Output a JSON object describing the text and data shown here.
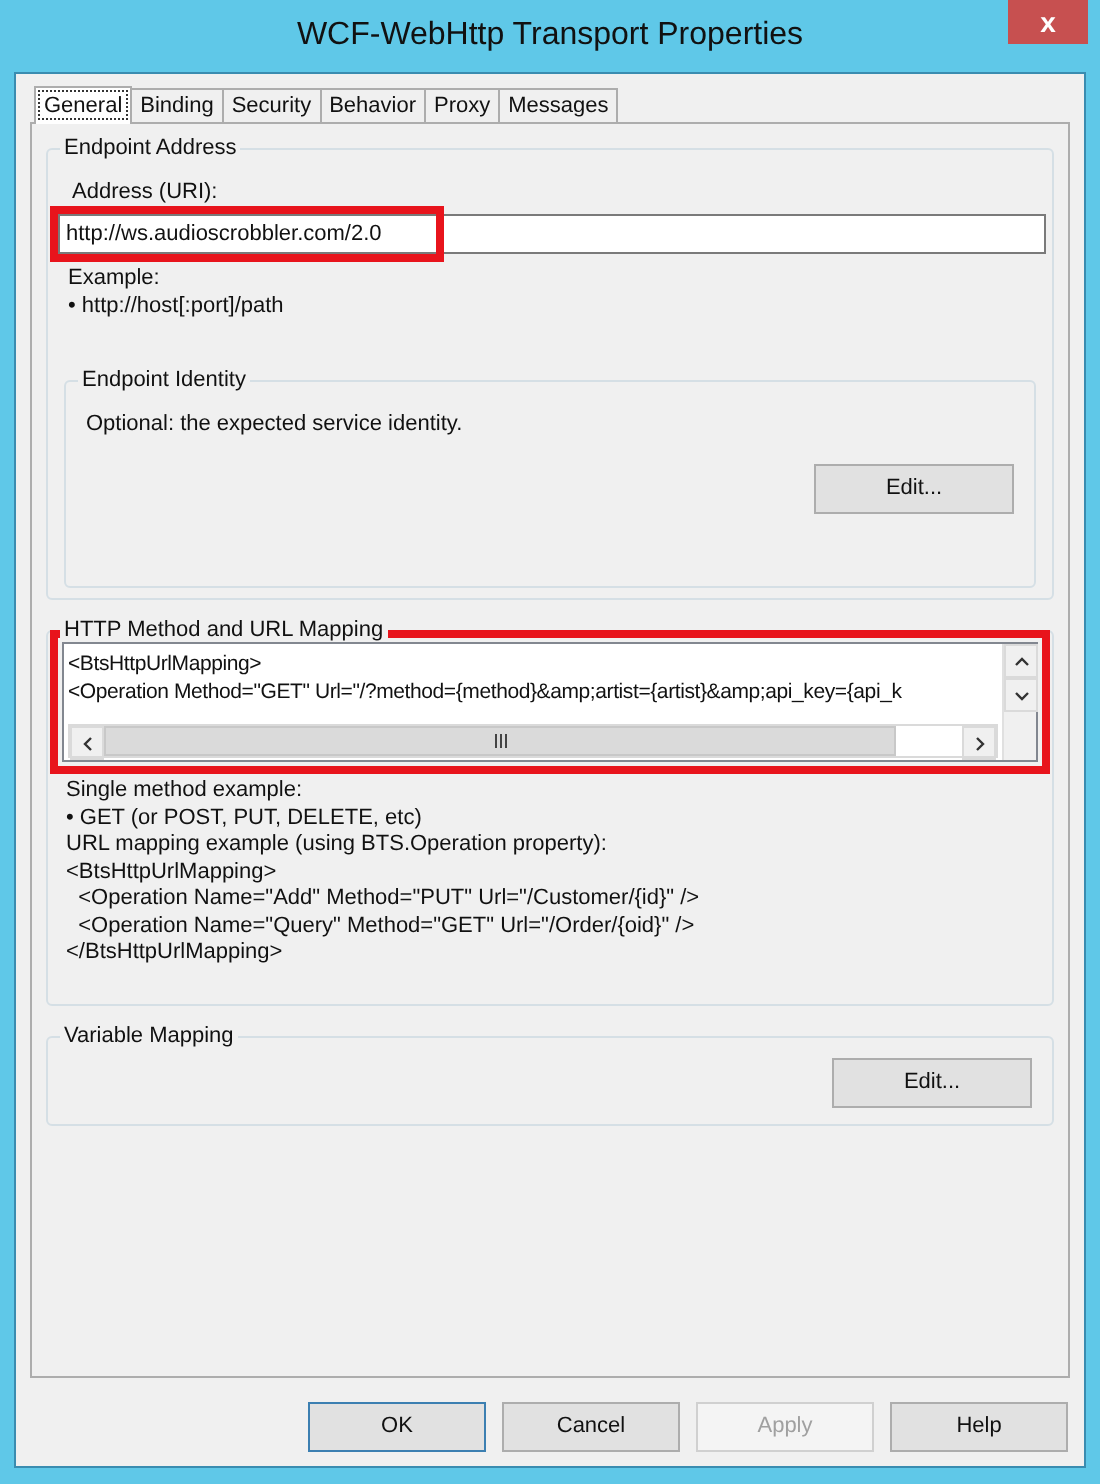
{
  "window": {
    "title": "WCF-WebHttp Transport Properties",
    "close": "x"
  },
  "tabs": [
    {
      "label": "General",
      "selected": true
    },
    {
      "label": "Binding",
      "selected": false
    },
    {
      "label": "Security",
      "selected": false
    },
    {
      "label": "Behavior",
      "selected": false
    },
    {
      "label": "Proxy",
      "selected": false
    },
    {
      "label": "Messages",
      "selected": false
    }
  ],
  "endpoint_address": {
    "title": "Endpoint Address",
    "address_label": "Address (URI):",
    "address_value": "http://ws.audioscrobbler.com/2.0",
    "highlighted": true,
    "example_label": "Example:",
    "example_lines": [
      "• http://host[:port]/path"
    ],
    "endpoint_identity": {
      "title": "Endpoint Identity",
      "description": "Optional: the expected service identity.",
      "button": "Edit..."
    }
  },
  "http_method_mapping": {
    "title": "HTTP Method and URL Mapping",
    "highlighted": true,
    "value_lines": [
      "<BtsHttpUrlMapping>",
      "<Operation Method=\"GET\" Url=\"/?method={method}&amp;artist={artist}&amp;api_key={api_k"
    ],
    "help_lines": [
      "Single method example:",
      "• GET (or POST, PUT, DELETE, etc)",
      "URL mapping example (using BTS.Operation property):",
      "<BtsHttpUrlMapping>",
      "  <Operation Name=\"Add\" Method=\"PUT\" Url=\"/Customer/{id}\" />",
      "  <Operation Name=\"Query\" Method=\"GET\" Url=\"/Order/{oid}\" />",
      "</BtsHttpUrlMapping>"
    ]
  },
  "variable_mapping": {
    "title": "Variable Mapping",
    "button": "Edit..."
  },
  "buttons": [
    {
      "label": "OK",
      "disabled": false,
      "default": true
    },
    {
      "label": "Cancel",
      "disabled": false,
      "default": false
    },
    {
      "label": "Apply",
      "disabled": true,
      "default": false
    },
    {
      "label": "Help",
      "disabled": false,
      "default": false
    }
  ]
}
